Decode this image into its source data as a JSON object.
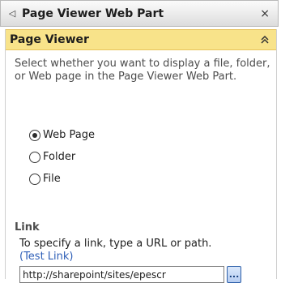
{
  "webpart": {
    "title": "Page Viewer Web Part",
    "left_icon": "◁",
    "close_glyph": "×"
  },
  "section": {
    "title": "Page Viewer",
    "collapse_icon": "double-chevron-up-icon"
  },
  "description": "Select whether you want to display a file, folder, or Web page in the Page Viewer Web Part.",
  "options": [
    {
      "label": "Web Page",
      "checked": true
    },
    {
      "label": "Folder",
      "checked": false
    },
    {
      "label": "File",
      "checked": false
    }
  ],
  "link": {
    "heading": "Link",
    "help_text": "To specify a link, type a URL or path.",
    "test_link_label": "(Test Link)",
    "value": "http://sharepoint/sites/epescr",
    "browse_label": "..."
  },
  "colors": {
    "section_header": "#f8e38a",
    "link_blue": "#3060b8"
  }
}
